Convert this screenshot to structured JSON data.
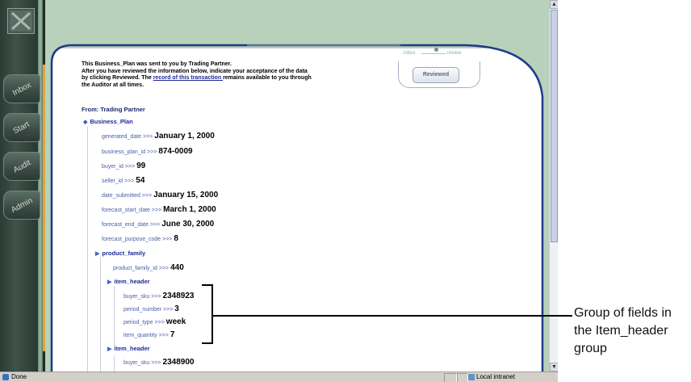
{
  "sidebar": {
    "tabs": [
      "Inbox",
      "Start",
      "Audit",
      "Admin"
    ]
  },
  "status_track": {
    "inbox": "inbox",
    "review": "review"
  },
  "reviewed_button": "Reviewed",
  "intro": {
    "line1": "This Business_Plan was sent to you by Trading Partner.",
    "line2": "After you have reviewed the information below, indicate your acceptance of the data",
    "line3_pre": "by clicking Reviewed. The ",
    "link": "record of this transaction ",
    "line3_post": "remains available to you through",
    "line4": "the Auditor at all times."
  },
  "from": "From: Trading Partner",
  "root_node": "Business_Plan",
  "fields": [
    {
      "name": "generated_date >>>",
      "value": "January 1, 2000"
    },
    {
      "name": "business_plan_id >>>",
      "value": "874-0009"
    },
    {
      "name": "buyer_id >>>",
      "value": "99"
    },
    {
      "name": "seller_id >>>",
      "value": "54"
    },
    {
      "name": "date_submitted >>>",
      "value": "January 15, 2000"
    },
    {
      "name": "forecast_start_date >>>",
      "value": "March 1, 2000"
    },
    {
      "name": "forecast_end_date >>>",
      "value": "June 30, 2000"
    },
    {
      "name": "forecast_purpose_code >>>",
      "value": "8"
    }
  ],
  "product_family": {
    "label": "product_family",
    "field": {
      "name": "product_family_id >>>",
      "value": "440"
    }
  },
  "item_header_1": {
    "label": "item_header",
    "fields": [
      {
        "name": "buyer_sku >>>",
        "value": "2348923"
      },
      {
        "name": "period_number >>>",
        "value": "3"
      },
      {
        "name": "period_type >>>",
        "value": "week"
      },
      {
        "name": "item_quantity >>>",
        "value": "7"
      }
    ]
  },
  "item_header_2": {
    "label": "item_header",
    "fields": [
      {
        "name": "buyer_sku >>>",
        "value": "2348900"
      }
    ]
  },
  "statusbar": {
    "done": "Done",
    "zone": "Local intranet"
  },
  "callout": {
    "line1": "Group of fields in",
    "line2": "the Item_header",
    "line3": "group"
  },
  "colors": {
    "banner": "#b8d1ba",
    "link": "#1c2a9a",
    "sidebar": "#3f5249",
    "accent": "#e0a63a"
  }
}
